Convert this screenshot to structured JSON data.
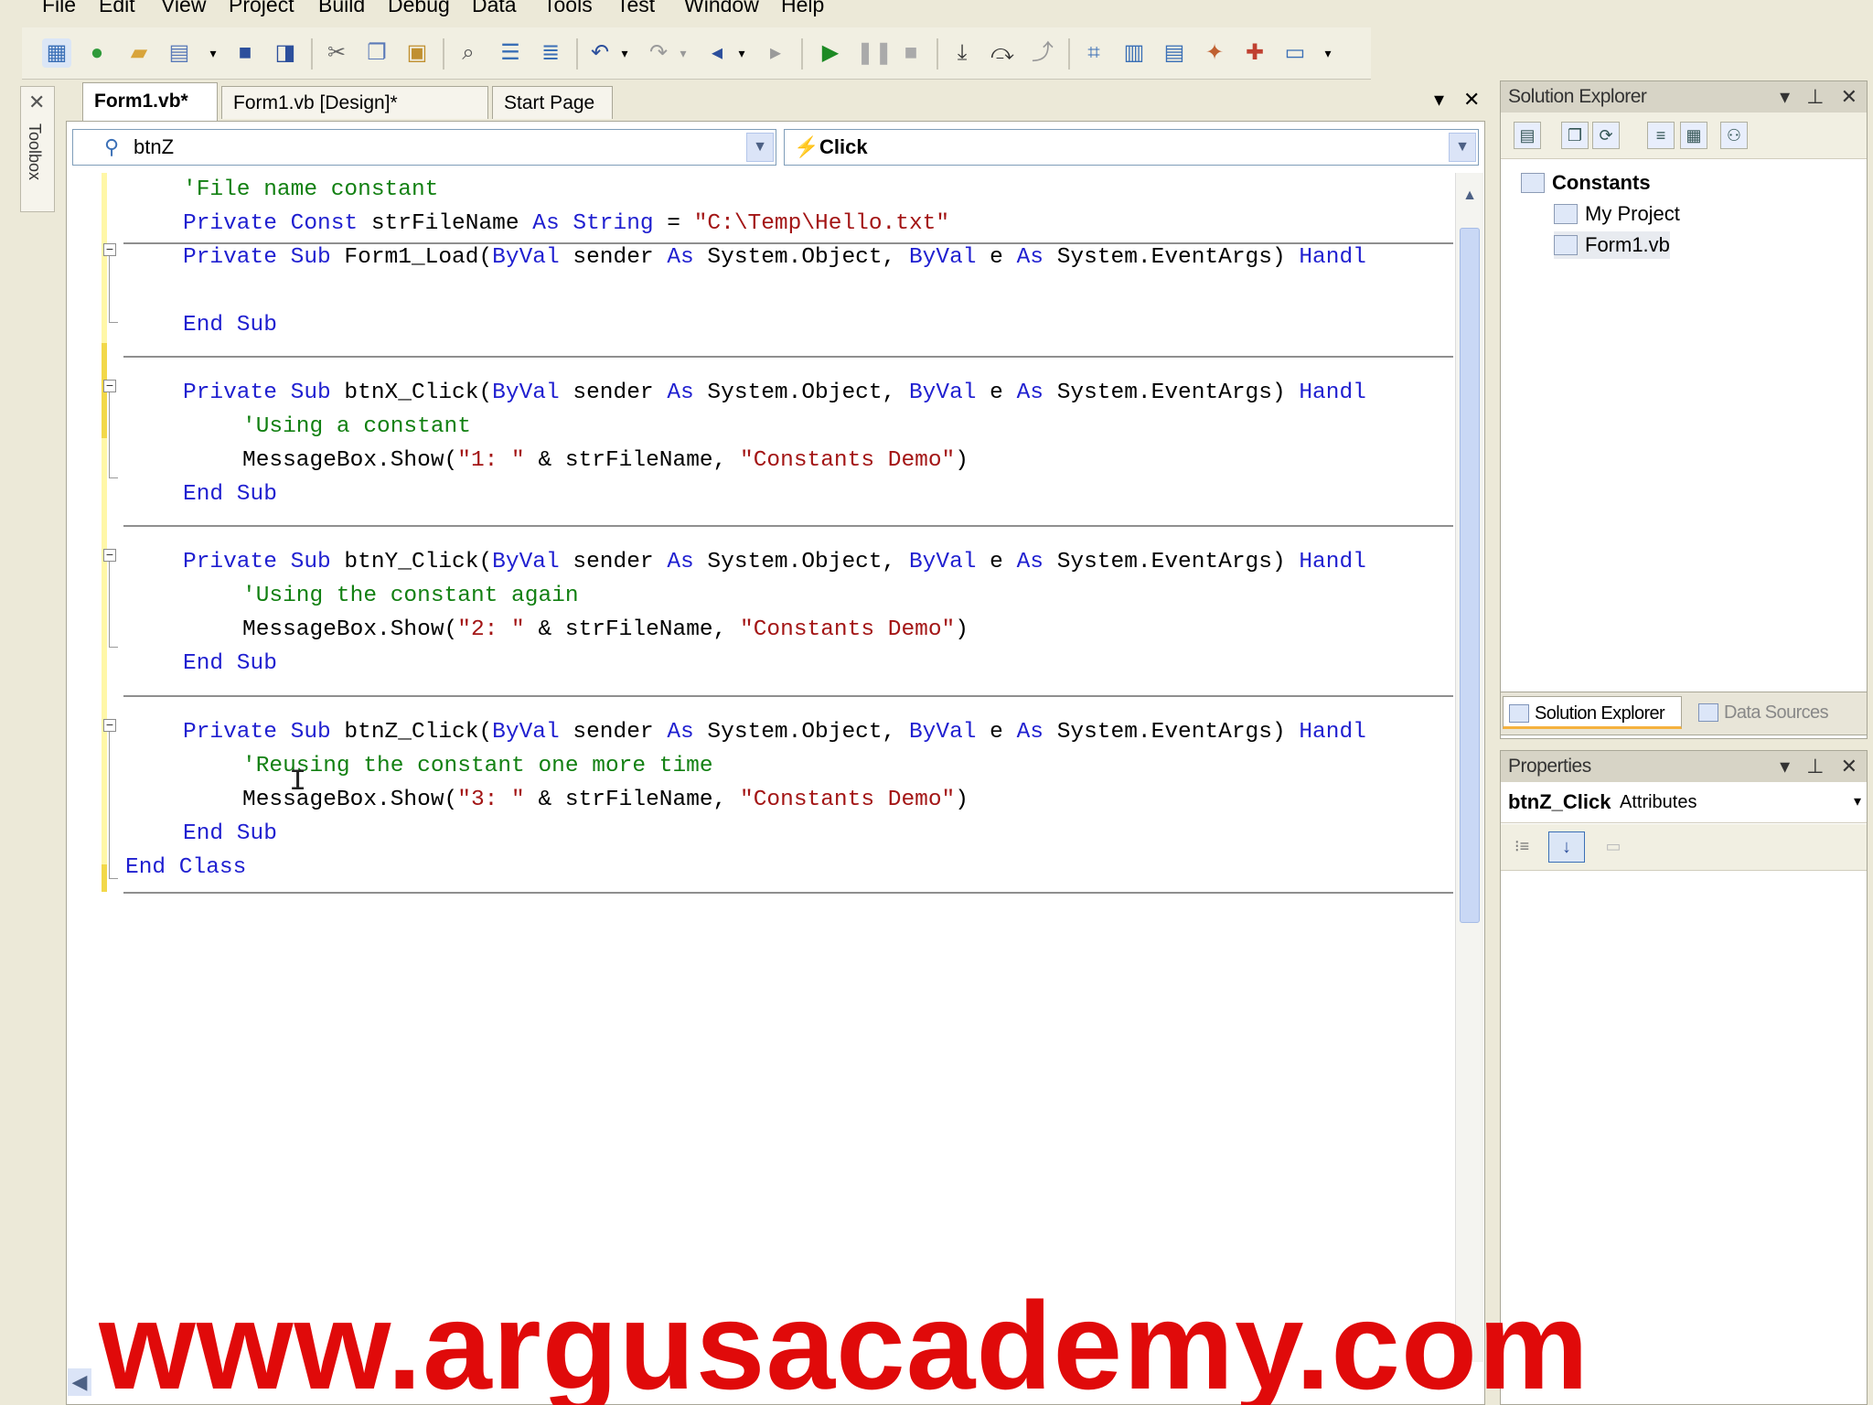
{
  "menu": {
    "items": [
      "File",
      "Edit",
      "View",
      "Project",
      "Build",
      "Debug",
      "Data",
      "Tools",
      "Test",
      "Window",
      "Help"
    ]
  },
  "toolbox": {
    "label": "Toolbox"
  },
  "tabs": [
    {
      "label": "Form1.vb*",
      "active": true
    },
    {
      "label": "Form1.vb [Design]*",
      "active": false
    },
    {
      "label": "Start Page",
      "active": false
    }
  ],
  "doc_controls": {
    "dropdown": "▾",
    "close": "✕"
  },
  "navbar": {
    "class_combo": "btnZ",
    "method_combo": "Click"
  },
  "code": {
    "comment_filename": "'File name constant",
    "const_private": "Private",
    "const_const": "Const",
    "const_name": " strFileName ",
    "const_as": "As",
    "const_type": "String",
    "const_eq": " = ",
    "const_value": "\"C:\\Temp\\Hello.txt\"",
    "load_private": "Private",
    "load_sub": "Sub",
    "load_name": " Form1_Load(",
    "byval1": "ByVal",
    "sender_as": " sender ",
    "as1": "As",
    "sysobj": " System.Object, ",
    "byval2": "ByVal",
    "e_as": " e ",
    "as2": "As",
    "sysargs": " System.EventArgs) ",
    "handl": "Handl",
    "end_sub": "End Sub",
    "btnx_name": " btnX_Click(",
    "btny_name": " btnY_Click(",
    "btnz_name": " btnZ_Click(",
    "comment_x": "'Using a constant",
    "comment_y": "'Using the constant again",
    "comment_z": "'Reusing the constant one more time",
    "msgbox_call": "MessageBox.Show(",
    "msg1": "\"1: \"",
    "msg2": "\"2: \"",
    "msg3": "\"3: \"",
    "concat": " & strFileName, ",
    "caption": "\"Constants Demo\"",
    "close_paren": ")",
    "end_class": "End Class"
  },
  "solution_explorer": {
    "title": "Solution Explorer",
    "root": "Constants",
    "items": [
      "My Project",
      "Form1.vb"
    ]
  },
  "bottom_tabs": [
    {
      "label": "Solution Explorer",
      "active": true
    },
    {
      "label": "Data Sources",
      "active": false
    }
  ],
  "properties": {
    "title": "Properties",
    "object_name": "btnZ_Click",
    "object_type": "Attributes"
  },
  "watermark": "www.argusacademy.com",
  "colors": {
    "keyword": "#1f1fd0",
    "comment": "#128012",
    "string": "#a31515",
    "watermark": "#e00a0a"
  },
  "icons": [
    "new-project-icon",
    "open-icon",
    "save-icon",
    "cut-icon",
    "copy-icon",
    "paste-icon",
    "undo-icon",
    "redo-icon",
    "start-debug-icon",
    "pause-icon",
    "stop-icon",
    "solution-explorer-icon",
    "properties-icon",
    "toolbox-icon"
  ]
}
